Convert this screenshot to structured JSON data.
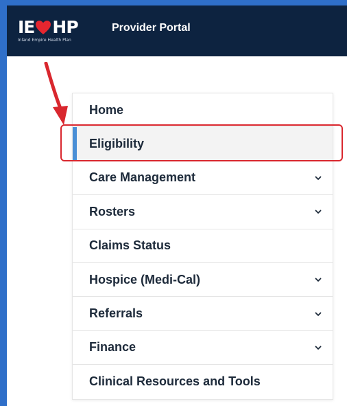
{
  "header": {
    "logo": {
      "text_left": "IE",
      "text_right": "HP",
      "tagline": "Inland Empire Health Plan"
    },
    "title": "Provider Portal"
  },
  "colors": {
    "header_bg": "#0d2340",
    "frame_bg": "#2f6fc9",
    "heart": "#e4262f",
    "active_bar": "#4a8fd6",
    "highlight": "#d9272e",
    "arrow": "#d9272e"
  },
  "menu": {
    "items": [
      {
        "label": "Home",
        "has_chevron": false,
        "active": false
      },
      {
        "label": "Eligibility",
        "has_chevron": false,
        "active": true
      },
      {
        "label": "Care Management",
        "has_chevron": true,
        "active": false
      },
      {
        "label": "Rosters",
        "has_chevron": true,
        "active": false
      },
      {
        "label": "Claims Status",
        "has_chevron": false,
        "active": false
      },
      {
        "label": "Hospice (Medi-Cal)",
        "has_chevron": true,
        "active": false
      },
      {
        "label": "Referrals",
        "has_chevron": true,
        "active": false
      },
      {
        "label": "Finance",
        "has_chevron": true,
        "active": false
      },
      {
        "label": "Clinical Resources and Tools",
        "has_chevron": false,
        "active": false
      }
    ]
  },
  "icons": {
    "chevron": "chevron-down-icon",
    "heart": "heart-icon",
    "annotation_arrow": "arrow-icon"
  }
}
